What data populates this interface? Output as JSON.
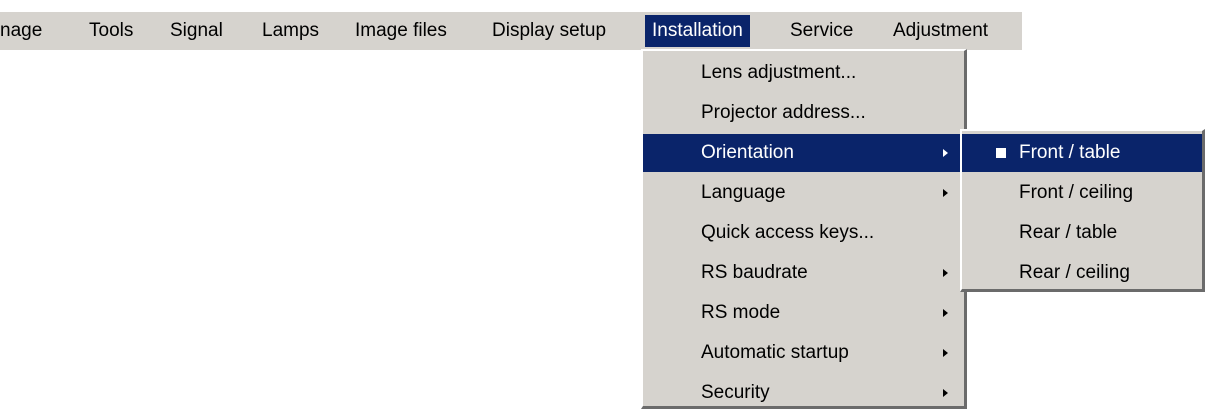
{
  "menubar": {
    "items": [
      {
        "label": "nage"
      },
      {
        "label": "Tools"
      },
      {
        "label": "Signal"
      },
      {
        "label": "Lamps"
      },
      {
        "label": "Image files"
      },
      {
        "label": "Display setup"
      },
      {
        "label": "Installation"
      },
      {
        "label": "Service"
      },
      {
        "label": "Adjustment"
      }
    ],
    "active": "Installation"
  },
  "installation_menu": {
    "items": [
      {
        "label": "Lens adjustment...",
        "submenu": false
      },
      {
        "label": "Projector address...",
        "submenu": false
      },
      {
        "label": "Orientation",
        "submenu": true,
        "highlighted": true
      },
      {
        "label": "Language",
        "submenu": true
      },
      {
        "label": "Quick access keys...",
        "submenu": false
      },
      {
        "label": "RS baudrate",
        "submenu": true
      },
      {
        "label": "RS mode",
        "submenu": true
      },
      {
        "label": "Automatic startup",
        "submenu": true
      },
      {
        "label": "Security",
        "submenu": true
      }
    ]
  },
  "orientation_menu": {
    "items": [
      {
        "label": "Front / table",
        "selected": true
      },
      {
        "label": "Front / ceiling",
        "selected": false
      },
      {
        "label": "Rear / table",
        "selected": false
      },
      {
        "label": "Rear / ceiling",
        "selected": false
      }
    ]
  },
  "colors": {
    "menu_bg": "#d6d3ce",
    "highlight_bg": "#0a246a",
    "highlight_fg": "#ffffff"
  }
}
